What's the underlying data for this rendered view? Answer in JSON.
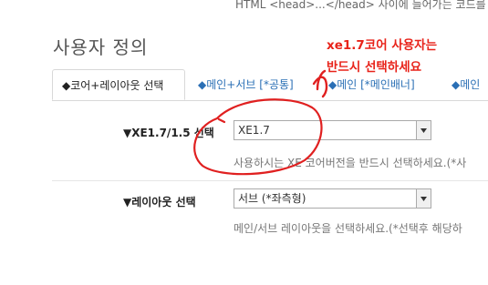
{
  "top_note": "HTML <head>...</head> 사이에 들어가는 코드를",
  "section_title": "사용자 정의",
  "tabs": [
    {
      "label": "◆코어+레이아웃 선택",
      "active": true
    },
    {
      "label": "◆메인+서브 [*공통]",
      "active": false
    },
    {
      "label": "◆메인 [*메인배너]",
      "active": false
    },
    {
      "label": "◆메인",
      "active": false
    }
  ],
  "fields": {
    "core": {
      "label": "▼XE1.7/1.5 선택",
      "value": "XE1.7",
      "help": "사용하시는 XE 코어버전을 반드시 선택하세요.(*사"
    },
    "layout": {
      "label": "▼레이아웃 선택",
      "value": "서브 (*좌측형)",
      "help": "메인/서브 레이아웃을 선택하세요.(*선택후 해당하"
    }
  },
  "annotation": {
    "line1": "xe1.7코어 사용자는",
    "line2": "반드시 선택하세요",
    "color": "#e8231a"
  },
  "colors": {
    "tab_link": "#2a6fb5",
    "annotation_red": "#e8231a"
  }
}
